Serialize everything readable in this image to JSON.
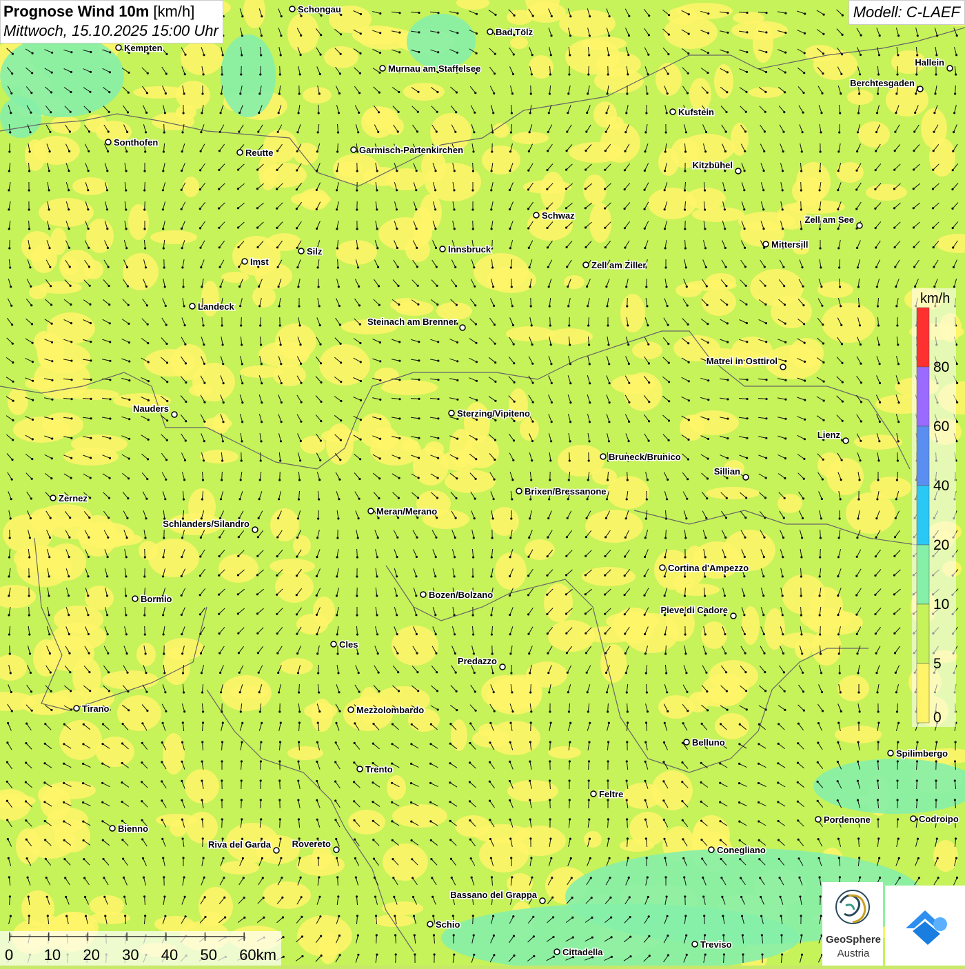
{
  "title": {
    "bold": "Prognose Wind 10m",
    "unit": "[km/h]",
    "datetime": "Mittwoch, 15.10.2025 15:00 Uhr"
  },
  "model": "Modell: C-LAEF",
  "legend": {
    "unit": "km/h",
    "ticks": [
      "80",
      "60",
      "40",
      "20",
      "10",
      "5",
      "0"
    ],
    "colors": [
      "#ff3030",
      "#9b6bff",
      "#5a8ef0",
      "#29c8f5",
      "#86efa8",
      "#c6f25a",
      "#fff46a"
    ]
  },
  "scale": {
    "labels": [
      "0",
      "10",
      "20",
      "30",
      "40",
      "50",
      "60km"
    ]
  },
  "logos": {
    "geosphere_line1": "GeoSphere",
    "geosphere_line2": "Austria"
  },
  "colors": {
    "calm": "#fff46a",
    "light": "#c6f25a",
    "moderate": "#86efa8",
    "background": "#c8e86a"
  },
  "cities": [
    {
      "name": "Schongau"
    },
    {
      "name": "Bad Tölz"
    },
    {
      "name": "Kempten"
    },
    {
      "name": "Murnau am Staffelsee"
    },
    {
      "name": "Hallein"
    },
    {
      "name": "Berchtesgaden"
    },
    {
      "name": "Kufstein"
    },
    {
      "name": "Sonthofen"
    },
    {
      "name": "Reutte"
    },
    {
      "name": "Garmisch-Partenkirchen"
    },
    {
      "name": "Kitzbühel"
    },
    {
      "name": "Schwaz"
    },
    {
      "name": "Zell am See"
    },
    {
      "name": "Mittersill"
    },
    {
      "name": "Silz"
    },
    {
      "name": "Innsbruck"
    },
    {
      "name": "Imst"
    },
    {
      "name": "Zell am Ziller"
    },
    {
      "name": "Landeck"
    },
    {
      "name": "Steinach am Brenner"
    },
    {
      "name": "Matrei in Osttirol"
    },
    {
      "name": "Nauders"
    },
    {
      "name": "Sterzing/Vipiteno"
    },
    {
      "name": "Lienz"
    },
    {
      "name": "Bruneck/Brunico"
    },
    {
      "name": "Sillian"
    },
    {
      "name": "Brixen/Bressanone"
    },
    {
      "name": "Zernez"
    },
    {
      "name": "Meran/Merano"
    },
    {
      "name": "Schlanders/Silandro"
    },
    {
      "name": "Cortina d'Ampezzo"
    },
    {
      "name": "Bozen/Bolzano"
    },
    {
      "name": "Bormio"
    },
    {
      "name": "Pieve di Cadore"
    },
    {
      "name": "Cles"
    },
    {
      "name": "Predazzo"
    },
    {
      "name": "Tirano"
    },
    {
      "name": "Mezzolombardo"
    },
    {
      "name": "Belluno"
    },
    {
      "name": "Spilimbergo"
    },
    {
      "name": "Trento"
    },
    {
      "name": "Feltre"
    },
    {
      "name": "Bienno"
    },
    {
      "name": "Pordenone"
    },
    {
      "name": "Codroipo"
    },
    {
      "name": "Riva del Garda"
    },
    {
      "name": "Rovereto"
    },
    {
      "name": "Conegliano"
    },
    {
      "name": "Bassano del Grappa"
    },
    {
      "name": "Schio"
    },
    {
      "name": "Treviso"
    },
    {
      "name": "Cittadella"
    }
  ]
}
